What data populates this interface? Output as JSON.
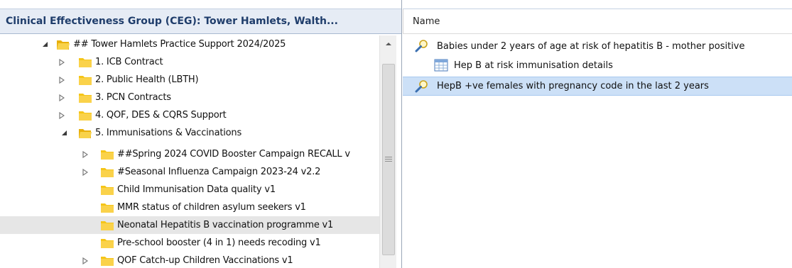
{
  "left_panel": {
    "title": "Clinical Effectiveness Group (CEG): Tower Hamlets, Walth...",
    "tree": [
      {
        "label": "## Tower Hamlets Practice Support 2024/2025",
        "expanded": true,
        "has_children": true,
        "icon": "folder-icon"
      },
      {
        "label": "1. ICB Contract",
        "expanded": false,
        "has_children": true,
        "icon": "folder-icon"
      },
      {
        "label": "2. Public Health (LBTH)",
        "expanded": false,
        "has_children": true,
        "icon": "folder-icon"
      },
      {
        "label": "3. PCN Contracts",
        "expanded": false,
        "has_children": true,
        "icon": "folder-icon"
      },
      {
        "label": "4. QOF, DES & CQRS Support",
        "expanded": false,
        "has_children": true,
        "icon": "folder-icon"
      },
      {
        "label": "5. Immunisations & Vaccinations",
        "expanded": true,
        "has_children": true,
        "icon": "folder-icon"
      },
      {
        "label": "##Spring 2024 COVID Booster Campaign RECALL v",
        "expanded": false,
        "has_children": true,
        "icon": "folder-icon"
      },
      {
        "label": "#Seasonal Influenza Campaign 2023-24 v2.2",
        "expanded": false,
        "has_children": true,
        "icon": "folder-icon"
      },
      {
        "label": "Child Immunisation Data quality v1",
        "expanded": false,
        "has_children": false,
        "icon": "folder-icon"
      },
      {
        "label": "MMR status of children asylum seekers v1",
        "expanded": false,
        "has_children": false,
        "icon": "folder-icon"
      },
      {
        "label": "Neonatal Hepatitis B vaccination programme v1",
        "expanded": false,
        "has_children": false,
        "icon": "folder-icon",
        "selected": true
      },
      {
        "label": "Pre-school booster (4 in 1) needs recoding v1",
        "expanded": false,
        "has_children": false,
        "icon": "folder-icon"
      },
      {
        "label": "QOF Catch-up Children Vaccinations v1",
        "expanded": false,
        "has_children": true,
        "icon": "folder-icon"
      }
    ]
  },
  "right_panel": {
    "column_header": "Name",
    "items": [
      {
        "label": "Babies under 2 years of age at risk of hepatitis B - mother positive",
        "icon": "search-query-icon"
      },
      {
        "label": "Hep B at risk immunisation details",
        "icon": "report-table-icon"
      },
      {
        "label": "HepB +ve females with pregnancy code in the last 2 years",
        "icon": "search-query-icon",
        "highlighted": true
      }
    ]
  },
  "colors": {
    "header_bg": "#e6ecf5",
    "header_text": "#1f3d6b",
    "folder": "#f5c518",
    "selection": "#cce0f7",
    "tree_selection": "#e6e6e6"
  }
}
